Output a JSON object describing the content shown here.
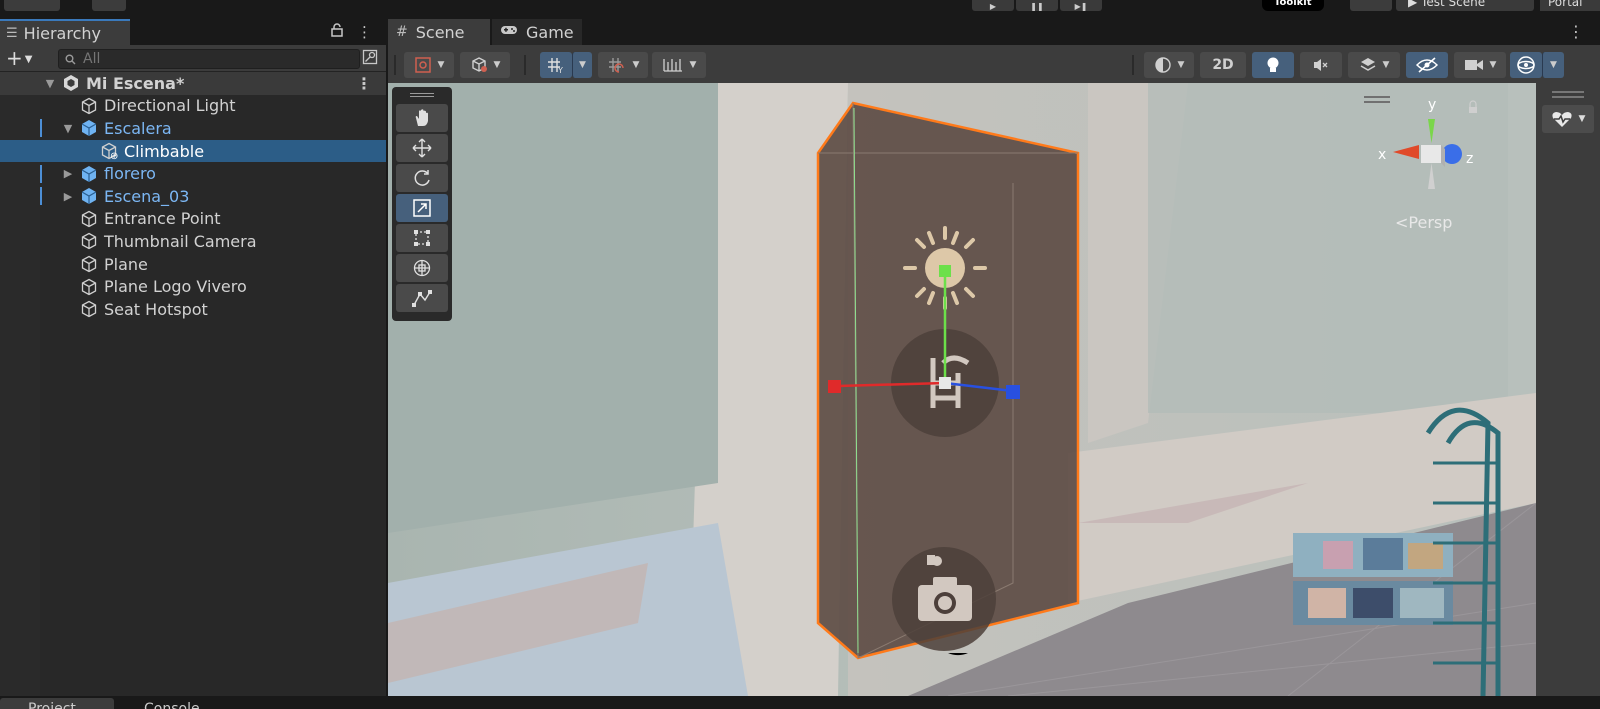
{
  "topbar": {
    "toolkit_label": "Toolkit",
    "test_scene_label": "Test Scene",
    "portal_label": "Portal"
  },
  "hierarchy": {
    "tab_label": "Hierarchy",
    "search_placeholder": "All",
    "scene_name": "Mi Escena*",
    "items": [
      {
        "label": "Directional Light",
        "indent": 1,
        "prefab": false,
        "expander": "none"
      },
      {
        "label": "Escalera",
        "indent": 1,
        "prefab": true,
        "expander": "expanded"
      },
      {
        "label": "Climbable",
        "indent": 2,
        "prefab": false,
        "expander": "none",
        "selected": true
      },
      {
        "label": "florero",
        "indent": 1,
        "prefab": true,
        "expander": "collapsed"
      },
      {
        "label": "Escena_03",
        "indent": 1,
        "prefab": true,
        "expander": "collapsed"
      },
      {
        "label": "Entrance Point",
        "indent": 1,
        "prefab": false,
        "expander": "none"
      },
      {
        "label": "Thumbnail Camera",
        "indent": 1,
        "prefab": false,
        "expander": "none"
      },
      {
        "label": "Plane",
        "indent": 1,
        "prefab": false,
        "expander": "none"
      },
      {
        "label": "Plane Logo Vivero",
        "indent": 1,
        "prefab": false,
        "expander": "none"
      },
      {
        "label": "Seat Hotspot",
        "indent": 1,
        "prefab": false,
        "expander": "none"
      }
    ]
  },
  "scene": {
    "tabs": [
      {
        "label": "Scene",
        "active": true
      },
      {
        "label": "Game",
        "active": false
      }
    ],
    "mode_2d_label": "2D",
    "gizmo": {
      "x": "x",
      "y": "y",
      "z": "z",
      "projection": "Persp"
    }
  },
  "bottom_tabs": [
    "Project",
    "Console"
  ],
  "colors": {
    "selection": "#2c5d87",
    "prefab_text": "#7cb7f4",
    "outline": "#ff7a1a",
    "accent": "#3a79bb"
  }
}
